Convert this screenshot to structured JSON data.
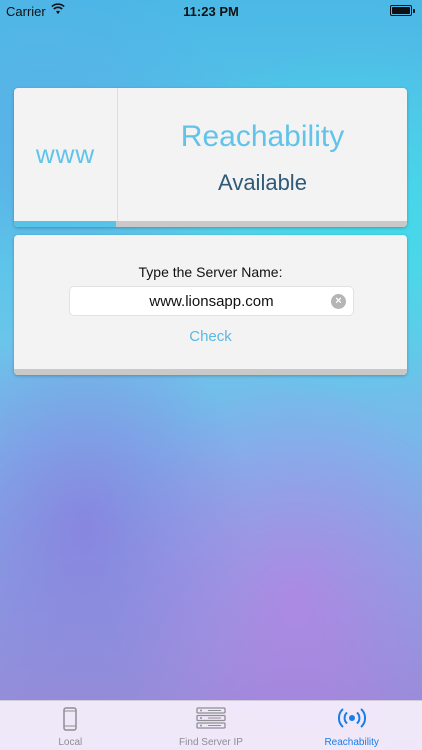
{
  "status_bar": {
    "carrier": "Carrier",
    "time": "11:23 PM"
  },
  "reachability_card": {
    "www_label": "www",
    "title": "Reachability",
    "status": "Available",
    "progress_fraction": 0.26
  },
  "server_form": {
    "prompt": "Type the Server Name:",
    "server_value": "www.lionsapp.com",
    "clear_symbol": "×",
    "check_label": "Check"
  },
  "tab_bar": {
    "tabs": [
      {
        "label": "Local",
        "icon": "phone-icon",
        "active": false
      },
      {
        "label": "Find Server IP",
        "icon": "server-rack-icon",
        "active": false
      },
      {
        "label": "Reachability",
        "icon": "broadcast-icon",
        "active": true
      }
    ]
  },
  "colors": {
    "accent": "#5bb8e3",
    "active_tab": "#1a7ee6",
    "status_text": "#2f5a78"
  }
}
